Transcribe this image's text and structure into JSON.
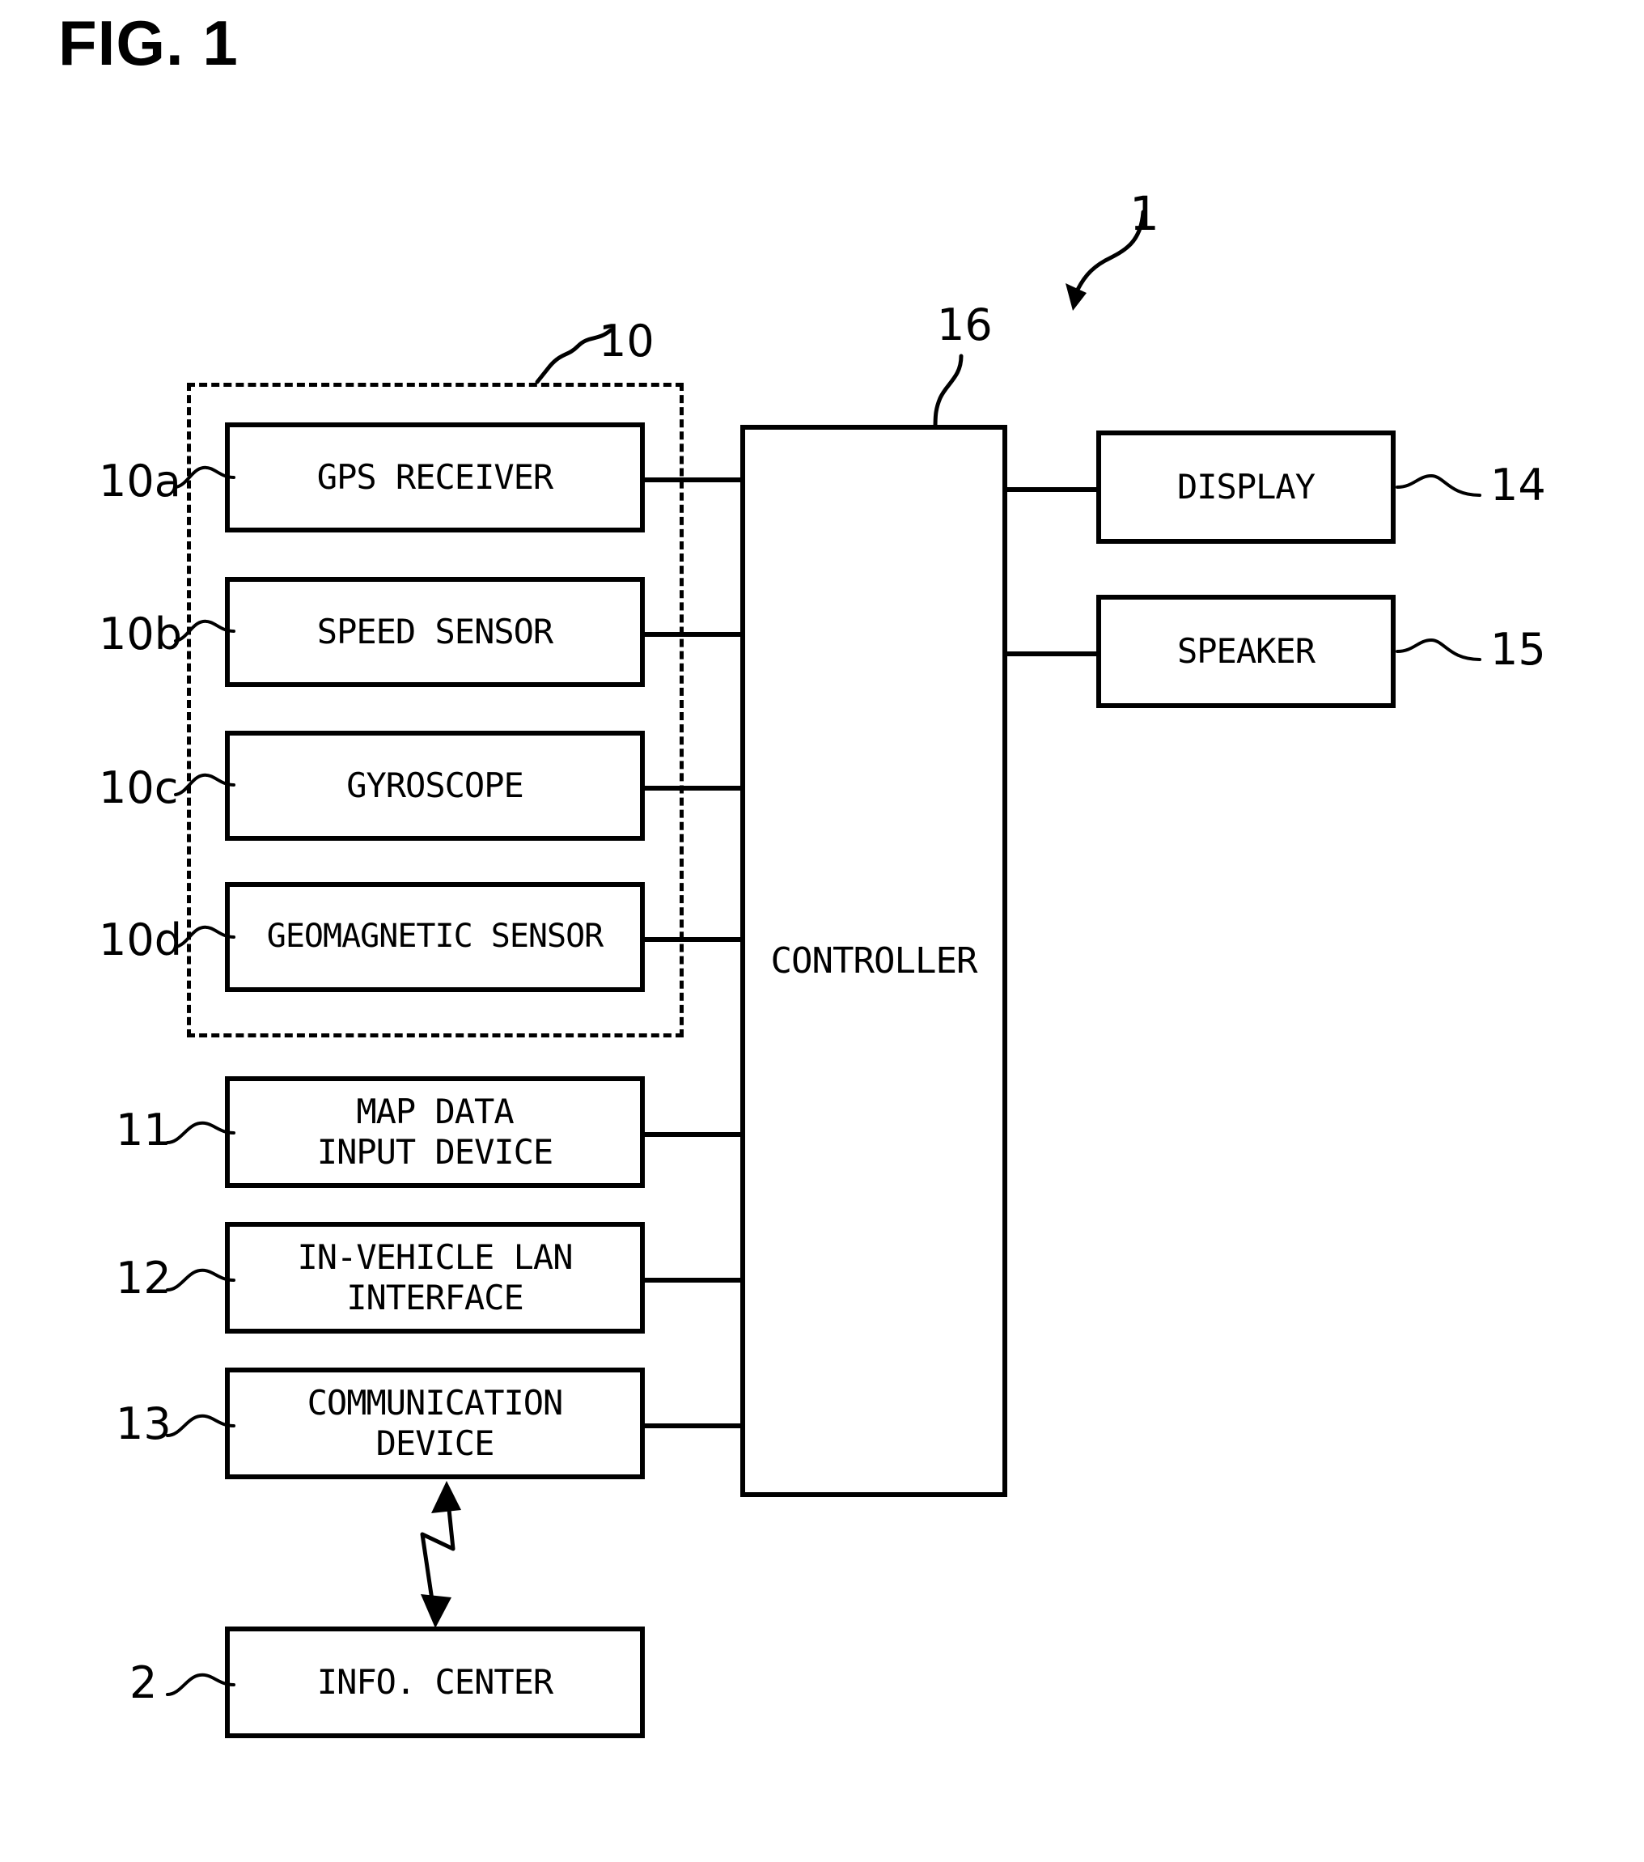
{
  "figure": {
    "title": "FIG. 1",
    "system_ref": "1",
    "sensor_group_ref": "10",
    "controller_ref": "16"
  },
  "nodes": {
    "gps_receiver": {
      "label": "GPS RECEIVER",
      "ref": "10a"
    },
    "speed_sensor": {
      "label": "SPEED SENSOR",
      "ref": "10b"
    },
    "gyroscope": {
      "label": "GYROSCOPE",
      "ref": "10c"
    },
    "geomagnetic_sensor": {
      "label": "GEOMAGNETIC SENSOR",
      "ref": "10d"
    },
    "map_data_input_device": {
      "label": "MAP DATA\nINPUT DEVICE",
      "ref": "11"
    },
    "in_vehicle_lan_interface": {
      "label": "IN-VEHICLE LAN\nINTERFACE",
      "ref": "12"
    },
    "communication_device": {
      "label": "COMMUNICATION\nDEVICE",
      "ref": "13"
    },
    "info_center": {
      "label": "INFO. CENTER",
      "ref": "2"
    },
    "controller": {
      "label": "CONTROLLER",
      "ref": "16"
    },
    "display": {
      "label": "DISPLAY",
      "ref": "14"
    },
    "speaker": {
      "label": "SPEAKER",
      "ref": "15"
    }
  },
  "colors": {
    "line": "#000000",
    "background": "#ffffff"
  }
}
